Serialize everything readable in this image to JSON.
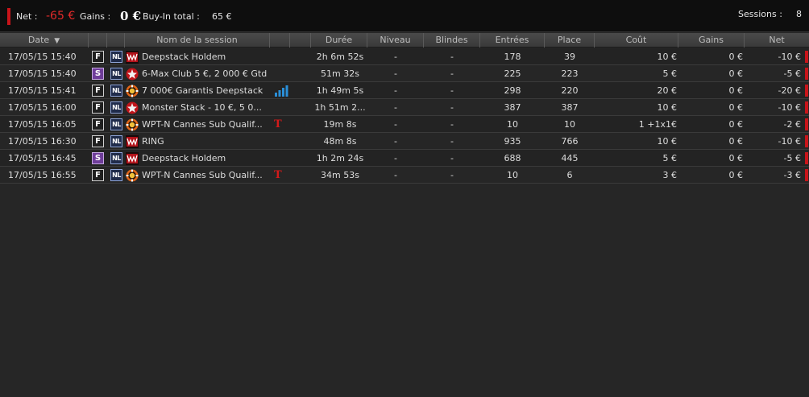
{
  "summary": {
    "net_label": "Net :",
    "net_value": "-65 €",
    "gains_label": "Gains :",
    "gains_value": "0 €",
    "buyin_label": "Buy-In total :",
    "buyin_value": "65 €",
    "sessions_label": "Sessions :",
    "sessions_value": "8"
  },
  "columns": {
    "date": "Date",
    "name": "Nom de la session",
    "duration": "Durée",
    "level": "Niveau",
    "blinds": "Blindes",
    "entries": "Entrées",
    "place": "Place",
    "cost": "Coût",
    "gains": "Gains",
    "net": "Net"
  },
  "colors": {
    "net_negative": "#e02a2a",
    "mode_s": "#6f3d9a",
    "marker_red": "#c8141a",
    "signal_blue": "#2a8fd8"
  },
  "rows": [
    {
      "date": "17/05/15 15:40",
      "mode": "F",
      "limit": "NL",
      "room": "winamax-icon",
      "name": "Deepstack Holdem",
      "extra": "",
      "duration": "2h 6m 52s",
      "level": "-",
      "blinds": "-",
      "entries": "178",
      "place": "39",
      "cost": "10 €",
      "gains": "0 €",
      "net": "-10 €"
    },
    {
      "date": "17/05/15 15:40",
      "mode": "S",
      "limit": "NL",
      "room": "pokerstars-icon",
      "name": "6-Max Club 5 €, 2 000 € Gtd",
      "extra": "",
      "duration": "51m 32s",
      "level": "-",
      "blinds": "-",
      "entries": "225",
      "place": "223",
      "cost": "5 €",
      "gains": "0 €",
      "net": "-5 €"
    },
    {
      "date": "17/05/15 15:41",
      "mode": "F",
      "limit": "NL",
      "room": "chip-icon",
      "name": "7 000€ Garantis Deepstack",
      "extra": "signal",
      "duration": "1h 49m 5s",
      "level": "-",
      "blinds": "-",
      "entries": "298",
      "place": "220",
      "cost": "20 €",
      "gains": "0 €",
      "net": "-20 €"
    },
    {
      "date": "17/05/15 16:00",
      "mode": "F",
      "limit": "NL",
      "room": "pokerstars-icon",
      "name": "Monster Stack - 10 €, 5 0...",
      "extra": "",
      "duration": "1h 51m 2...",
      "level": "-",
      "blinds": "-",
      "entries": "387",
      "place": "387",
      "cost": "10 €",
      "gains": "0 €",
      "net": "-10 €"
    },
    {
      "date": "17/05/15 16:05",
      "mode": "F",
      "limit": "NL",
      "room": "chip-icon",
      "name": "WPT-N Cannes Sub Qualif...",
      "extra": "T",
      "duration": "19m 8s",
      "level": "-",
      "blinds": "-",
      "entries": "10",
      "place": "10",
      "cost": "1  +1x1€",
      "gains": "0 €",
      "net": "-2 €"
    },
    {
      "date": "17/05/15 16:30",
      "mode": "F",
      "limit": "NL",
      "room": "winamax-icon",
      "name": "RING",
      "extra": "",
      "duration": "48m 8s",
      "level": "-",
      "blinds": "-",
      "entries": "935",
      "place": "766",
      "cost": "10 €",
      "gains": "0 €",
      "net": "-10 €"
    },
    {
      "date": "17/05/15 16:45",
      "mode": "S",
      "limit": "NL",
      "room": "winamax-icon",
      "name": "Deepstack Holdem",
      "extra": "",
      "duration": "1h 2m 24s",
      "level": "-",
      "blinds": "-",
      "entries": "688",
      "place": "445",
      "cost": "5 €",
      "gains": "0 €",
      "net": "-5 €"
    },
    {
      "date": "17/05/15 16:55",
      "mode": "F",
      "limit": "NL",
      "room": "chip-icon",
      "name": "WPT-N Cannes Sub Qualif...",
      "extra": "T",
      "duration": "34m 53s",
      "level": "-",
      "blinds": "-",
      "entries": "10",
      "place": "6",
      "cost": "3 €",
      "gains": "0 €",
      "net": "-3 €"
    }
  ]
}
